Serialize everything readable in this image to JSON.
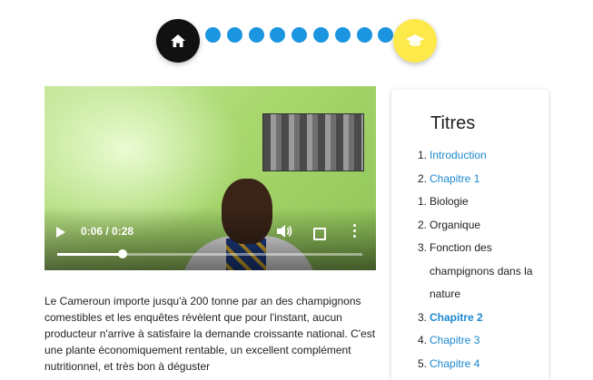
{
  "stepper": {
    "start_icon": "home-icon",
    "end_icon": "graduation-cap-icon",
    "dot_count": 9,
    "colors": {
      "start": "#111111",
      "dot": "#1b95e0",
      "end": "#fde94a"
    }
  },
  "video": {
    "time_label": "0:06 / 0:28",
    "progress": 0.214,
    "controls": [
      "play-icon",
      "volume-icon",
      "fullscreen-icon",
      "more-options-icon"
    ]
  },
  "description": "Le Cameroun importe jusqu'à 200 tonne par an des champignons comestibles et les enquêtes révèlent que pour l'instant, aucun producteur n'arrive à satisfaire la demande croissante national. C'est une plante économiquement rentable, un excellent complément nutritionnel, et très bon à déguster",
  "toc": {
    "title": "Titres",
    "items": [
      {
        "num": "1.",
        "label": "Introduction",
        "link": true,
        "bold": false
      },
      {
        "num": "2.",
        "label": "Chapitre 1",
        "link": true,
        "bold": false
      },
      {
        "num": "1.",
        "label": "Biologie",
        "link": false,
        "bold": false
      },
      {
        "num": "2.",
        "label": "Organique",
        "link": false,
        "bold": false
      },
      {
        "num": "3.",
        "label": "Fonction des champignons dans la nature",
        "link": false,
        "bold": false
      },
      {
        "num": "3.",
        "label": "Chapitre 2",
        "link": true,
        "bold": true
      },
      {
        "num": "4.",
        "label": "Chapitre 3",
        "link": true,
        "bold": false
      },
      {
        "num": "5.",
        "label": "Chapitre 4",
        "link": true,
        "bold": false
      }
    ]
  }
}
